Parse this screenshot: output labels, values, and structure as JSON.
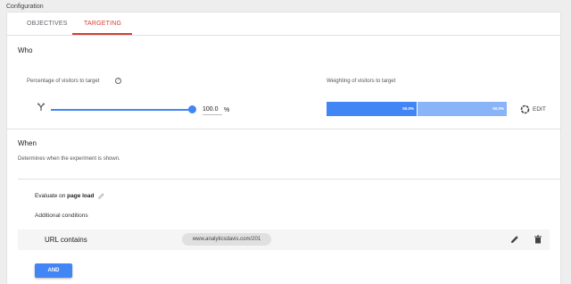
{
  "header": {
    "title": "Configuration"
  },
  "tabs": [
    {
      "label": "OBJECTIVES",
      "active": false
    },
    {
      "label": "TARGETING",
      "active": true
    }
  ],
  "who": {
    "title": "Who",
    "percentage_label": "Percentage of visitors to target",
    "percentage_value": "100.0",
    "percentage_unit": "%",
    "slider_fraction": 1.0,
    "weighting_label": "Weighting of visitors to target",
    "weights": [
      "50.0%",
      "50.0%"
    ],
    "edit_label": "EDIT"
  },
  "when": {
    "title": "When",
    "description": "Determines when the experiment is shown.",
    "evaluate_prefix": "Evaluate on ",
    "evaluate_value": "page load",
    "additional_label": "Additional conditions",
    "condition": {
      "label": "URL contains",
      "value": "www.analyticsdavis.com/201"
    },
    "and_button": "AND"
  },
  "colors": {
    "accent_red": "#d23f31",
    "primary_blue": "#4285f4",
    "light_blue": "#8ab4f8"
  }
}
